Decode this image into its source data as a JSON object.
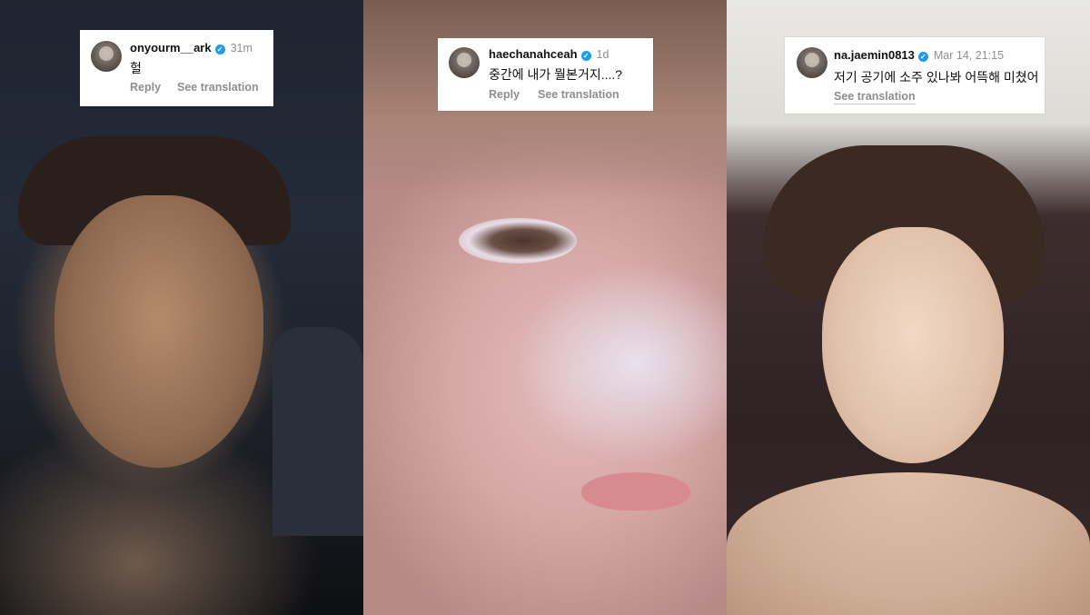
{
  "comments": [
    {
      "username": "onyourm__ark",
      "time": "31m",
      "text": "헐",
      "reply": "Reply",
      "translate": "See translation"
    },
    {
      "username": "haechanahceah",
      "time": "1d",
      "text": "중간에 내가 뭘본거지....?",
      "reply": "Reply",
      "translate": "See translation"
    },
    {
      "username": "na.jaemin0813",
      "time": "Mar 14, 21:15",
      "text": "저기 공기에 소주 있나봐 어뜩해 미쳤어",
      "translate": "See translation"
    }
  ],
  "colors": {
    "verified": "#1d9bf0",
    "username": "#111111",
    "meta": "#8e8e8e"
  }
}
